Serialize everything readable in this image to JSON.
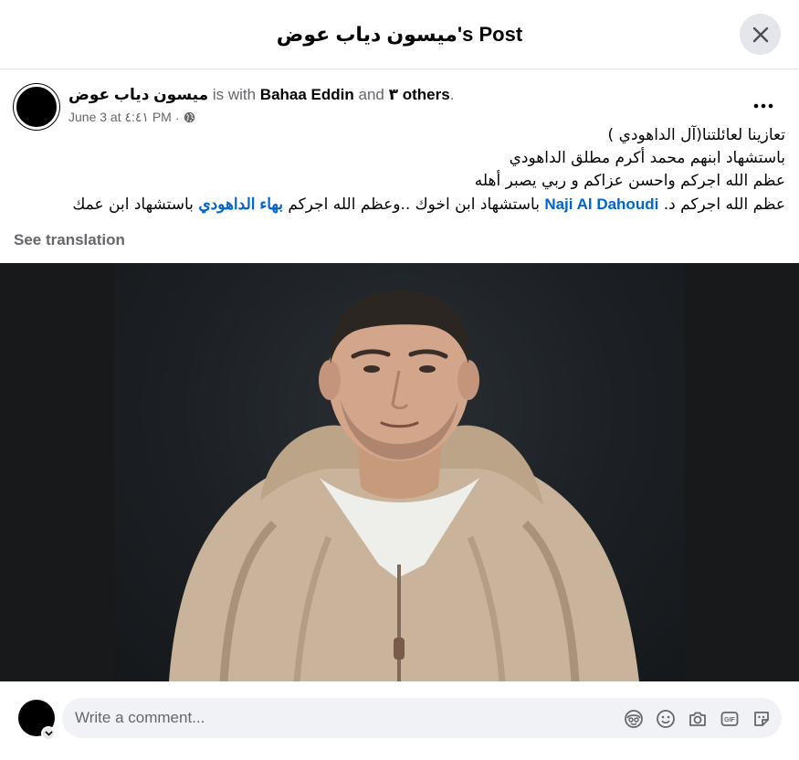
{
  "header": {
    "title": "ميسون دياب عوض's Post"
  },
  "post": {
    "author": "ميسون دياب عوض",
    "with_text": "is with",
    "tagged": "Bahaa Eddin",
    "and_text": "and",
    "others": "٣ others",
    "period": ".",
    "date": "June 3 at ٤:٤١ PM",
    "dot": "·",
    "audience_icon": "globe-icon",
    "text": {
      "line1": "تعازينا لعائلتنا(آل الداهودي )",
      "line2": "باستشهاد ابنهم محمد أكرم مطلق الداهودي",
      "line3": "عظم الله اجركم واحسن عزاكم و ربي يصبر أهله",
      "line4_part1": "عظم الله اجركم د.",
      "line4_link1": "Naji Al Dahoudi",
      "line4_part2": "باستشهاد ابن اخوك ..وعظم الله اجركم",
      "line4_link2": "بهاء الداهودي",
      "line4_part3": "باستشهاد ابن عمك"
    },
    "see_translation": "See translation"
  },
  "comment": {
    "placeholder": "Write a comment...",
    "icons": [
      "avatar-sticker-icon",
      "emoji-icon",
      "camera-icon",
      "gif-icon",
      "sticker-icon"
    ]
  },
  "colors": {
    "link": "#0064d1",
    "muted": "#65676b",
    "input_bg": "#f0f2f5",
    "button_bg": "#e4e6eb"
  }
}
